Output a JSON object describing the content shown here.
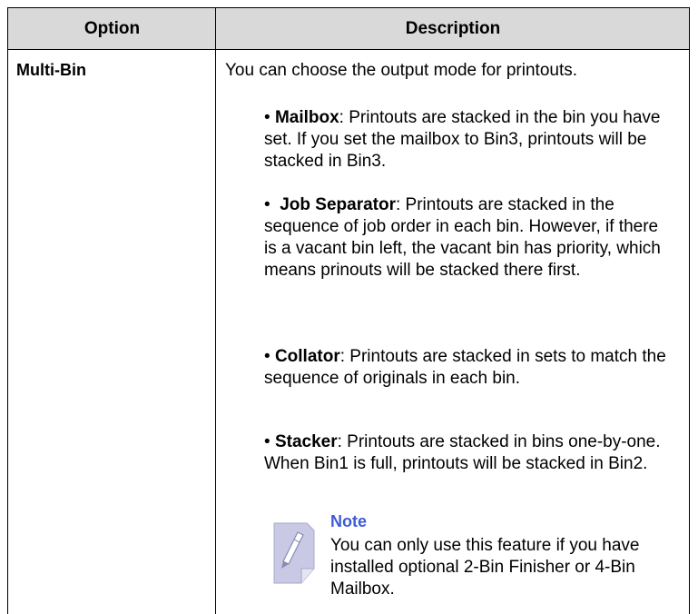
{
  "table": {
    "headers": {
      "option": "Option",
      "description": "Description"
    },
    "row": {
      "option": "Multi-Bin",
      "intro": "You can choose the output mode for printouts.",
      "bullets": [
        {
          "term": "Mailbox",
          "text": ": Printouts are stacked in the bin you have set. If you set the mailbox to Bin3, printouts will be stacked in Bin3."
        },
        {
          "term": "Job Separator",
          "text": ": Printouts are stacked in the sequence of job order in each bin. However, if there is a vacant bin left, the vacant bin has priority, which means prinouts will be stacked there first."
        },
        {
          "term": "Collator",
          "text": ": Printouts are stacked in sets to match the sequence of originals in each bin."
        },
        {
          "term": "Stacker",
          "text": ": Printouts are stacked in bins one-by-one. When Bin1 is full, printouts will be stacked in Bin2."
        }
      ],
      "note": {
        "icon": "note-pencil-icon",
        "title": "Note",
        "text": "You can only use this feature if you have installed optional 2-Bin Finisher or 4-Bin Mailbox."
      }
    }
  },
  "colors": {
    "header_background": "#d9d9d9",
    "note_title": "#3d5bd6",
    "note_icon": "#c9c9e6"
  }
}
